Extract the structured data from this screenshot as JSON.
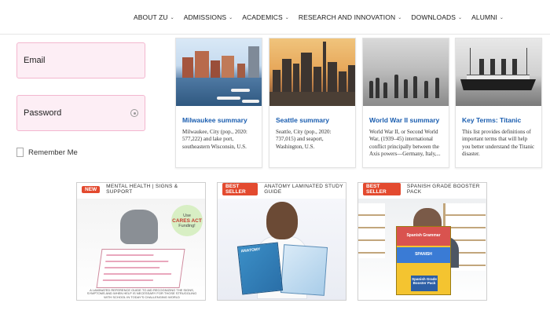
{
  "nav": {
    "items": [
      {
        "label": "ABOUT ZU"
      },
      {
        "label": "ADMISSIONS"
      },
      {
        "label": "ACADEMICS"
      },
      {
        "label": "RESEARCH AND INNOVATION"
      },
      {
        "label": "DOWNLOADS"
      },
      {
        "label": "ALUMNI"
      }
    ],
    "chevron_icon": "chevron-down-icon"
  },
  "login": {
    "email_placeholder": "Email",
    "password_placeholder": "Password",
    "eye_icon": "eye-icon",
    "remember_label": "Remember Me"
  },
  "cards": [
    {
      "title": "Milwaukee summary",
      "text": "Milwaukee, City (pop., 2020: 577,222) and lake port, southeastern Wisconsin, U.S."
    },
    {
      "title": "Seattle summary",
      "text": "Seattle, City (pop., 2020: 737,015) and seaport, Washington, U.S."
    },
    {
      "title": "World War II summary",
      "text": "World War II, or Second World War, (1939–45) international conflict principally between the Axis powers—Germany, Italy,..."
    },
    {
      "title": "Key Terms: Titanic",
      "text": "This list provides definitions of important terms that will help you better understand the Titanic disaster."
    }
  ],
  "products": [
    {
      "badge": "NEW",
      "badge_text": "MENTAL HEALTH | SIGNS & SUPPORT",
      "circle_line1": "Use",
      "circle_line2": "CARES ACT",
      "circle_line3": "Funding!",
      "caption": "A laminated reference guide to aid recognizing the signs, symptoms and when help is necessary for those struggling with school in today's challenging world"
    },
    {
      "badge": "BEST SELLER",
      "badge_text": "ANATOMY LAMINATED STUDY GUIDE",
      "book_label": "ANATOMY"
    },
    {
      "badge": "BEST SELLER",
      "badge_text": "SPANISH GRADE BOOSTER PACK",
      "pack_word1": "Spanish Grammar",
      "pack_word2": "SPANISH",
      "pack_label": "Spanish Grade Booster Pack"
    }
  ],
  "colors": {
    "accent_link": "#1b5eb0",
    "input_bg": "#fdeef5",
    "input_border": "#f3b7cf",
    "badge_bg": "#e34a2f"
  }
}
